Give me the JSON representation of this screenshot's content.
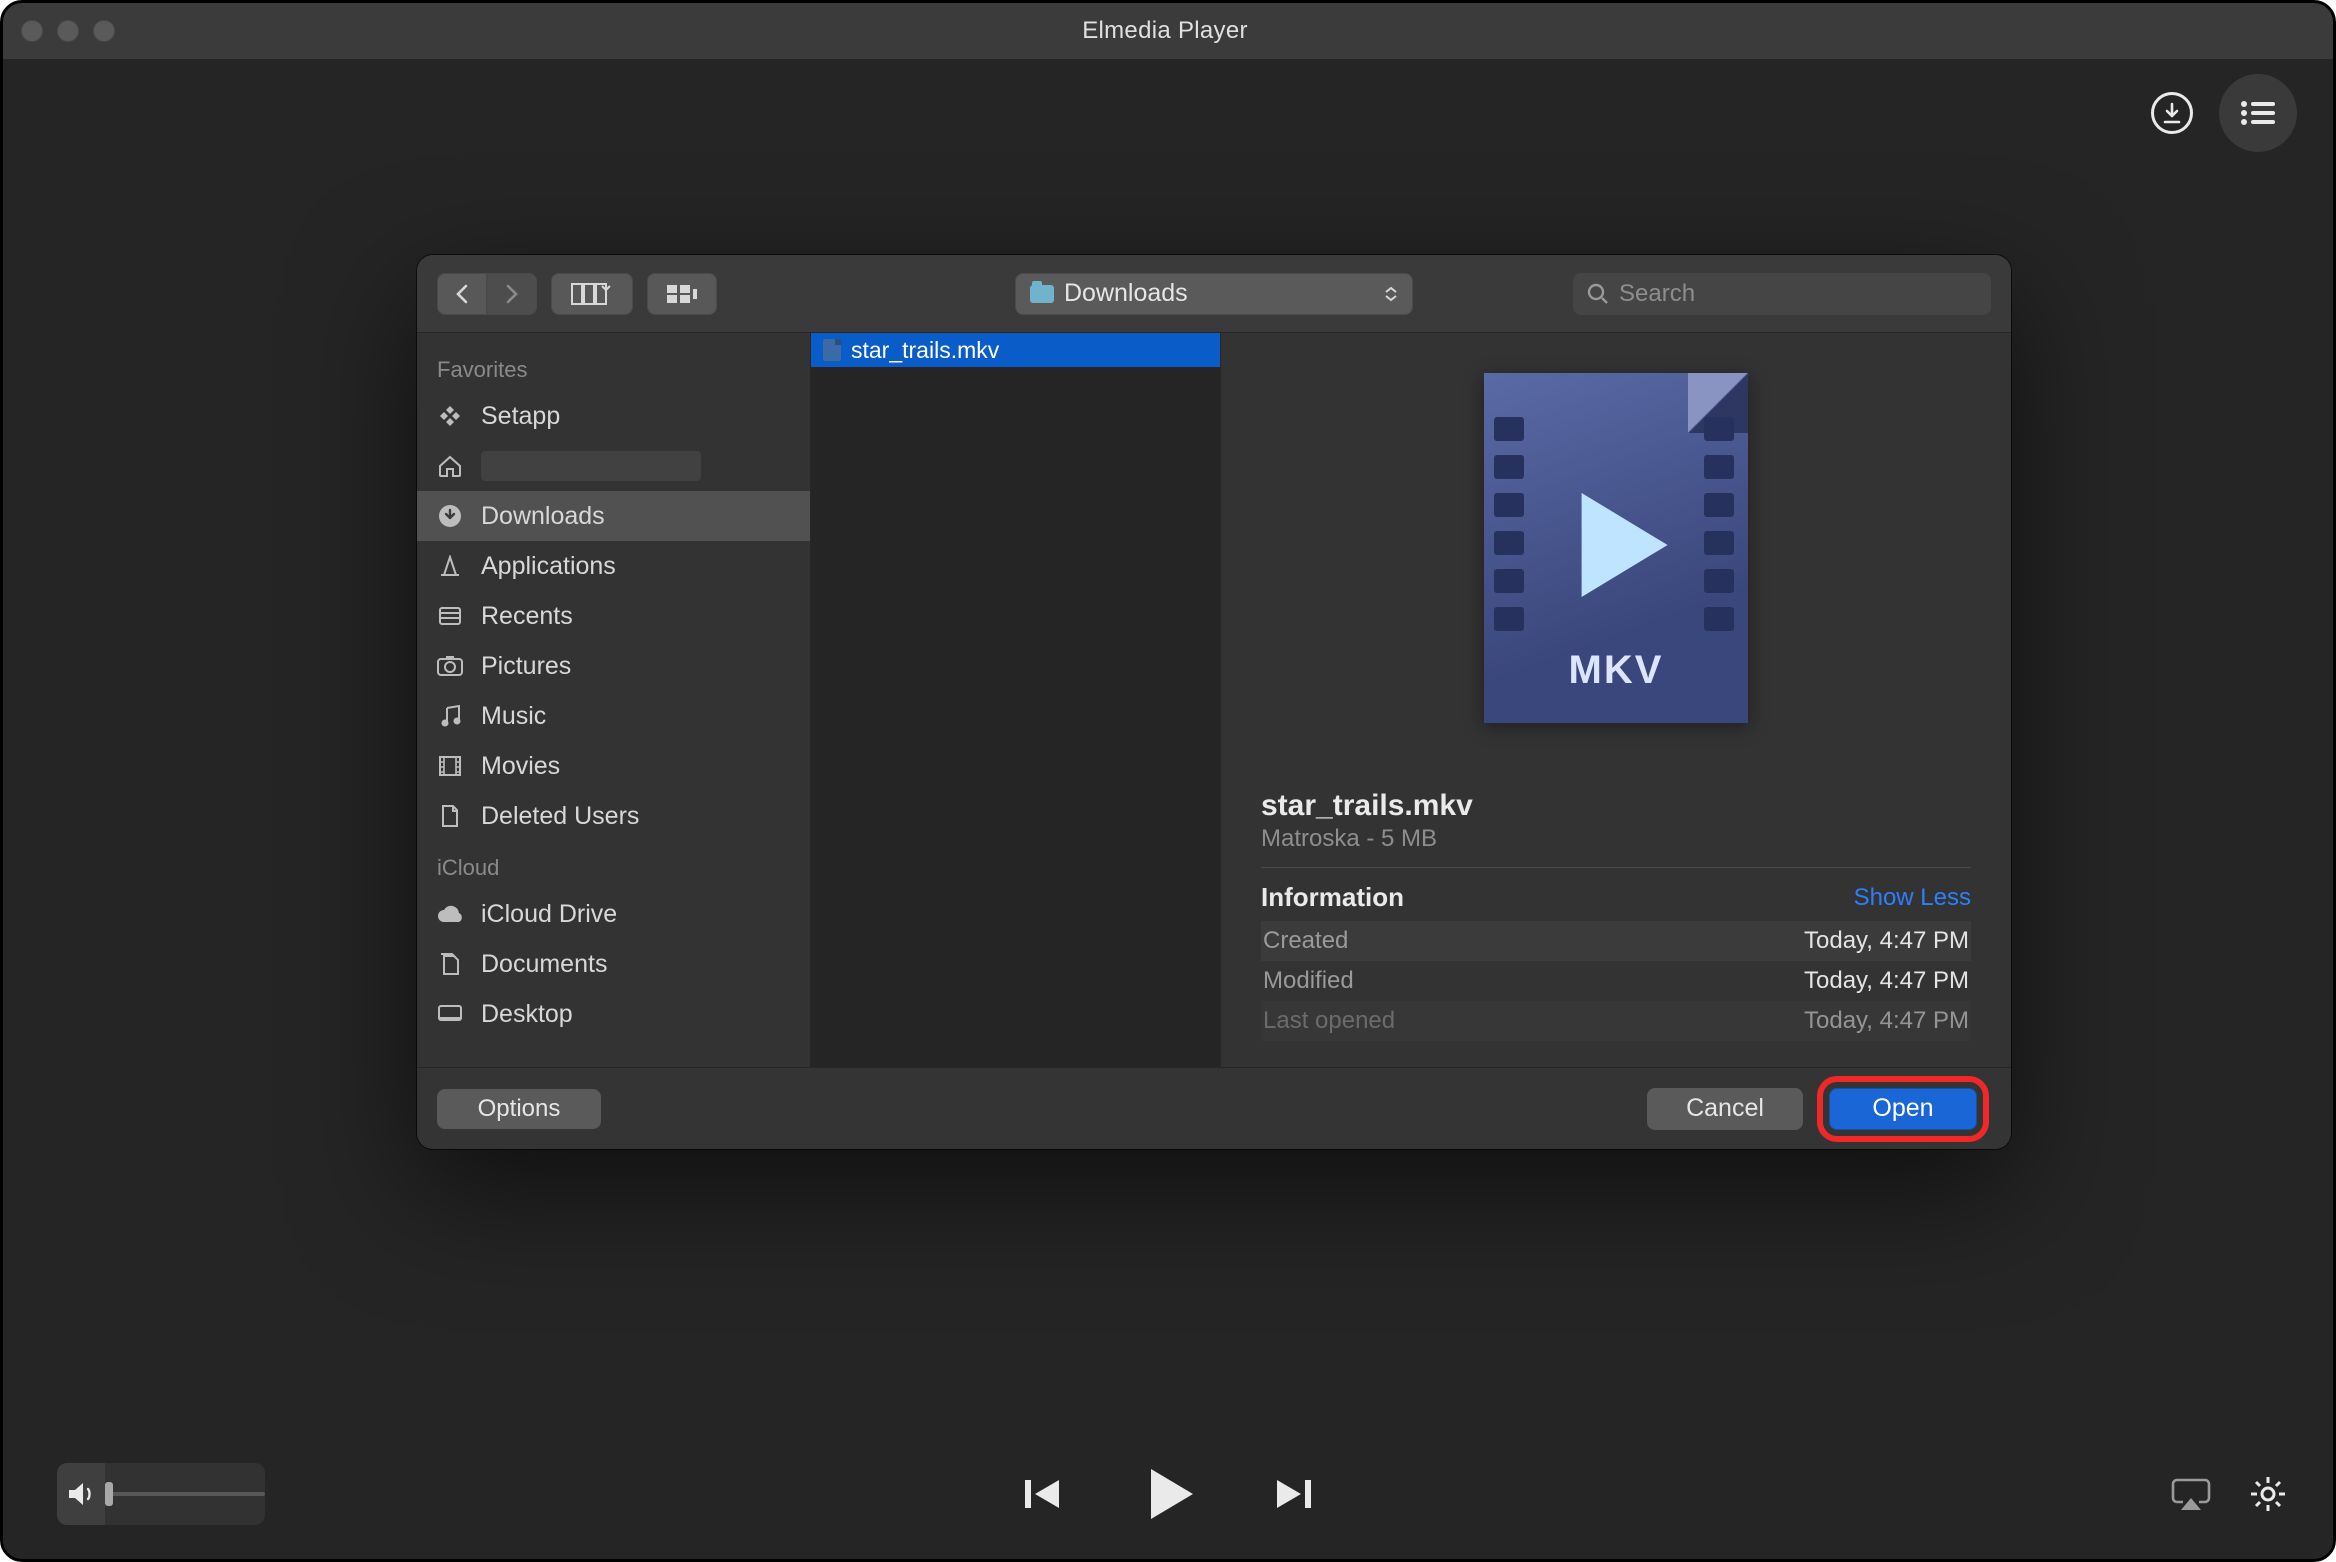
{
  "window": {
    "title": "Elmedia Player"
  },
  "dialog": {
    "path_label": "Downloads",
    "search_placeholder": "Search",
    "sidebar": {
      "sections": [
        {
          "header": "Favorites",
          "items": [
            {
              "label": "Setapp",
              "icon": "setapp"
            },
            {
              "label": "",
              "icon": "home",
              "home_empty": true
            },
            {
              "label": "Downloads",
              "icon": "downloads",
              "selected": true
            },
            {
              "label": "Applications",
              "icon": "applications"
            },
            {
              "label": "Recents",
              "icon": "recents"
            },
            {
              "label": "Pictures",
              "icon": "pictures"
            },
            {
              "label": "Music",
              "icon": "music"
            },
            {
              "label": "Movies",
              "icon": "movies"
            },
            {
              "label": "Deleted Users",
              "icon": "document"
            }
          ]
        },
        {
          "header": "iCloud",
          "items": [
            {
              "label": "iCloud Drive",
              "icon": "cloud"
            },
            {
              "label": "Documents",
              "icon": "documents"
            },
            {
              "label": "Desktop",
              "icon": "desktop"
            }
          ]
        }
      ]
    },
    "files": [
      {
        "name": "star_trails.mkv",
        "selected": true
      }
    ],
    "preview": {
      "badge": "MKV",
      "filename": "star_trails.mkv",
      "subtext": "Matroska - 5 MB",
      "info_header": "Information",
      "show_less": "Show Less",
      "rows": [
        {
          "k": "Created",
          "v": "Today, 4:47 PM"
        },
        {
          "k": "Modified",
          "v": "Today, 4:47 PM"
        },
        {
          "k": "Last opened",
          "v": "Today, 4:47 PM"
        }
      ]
    },
    "footer": {
      "options": "Options",
      "cancel": "Cancel",
      "open": "Open"
    }
  }
}
